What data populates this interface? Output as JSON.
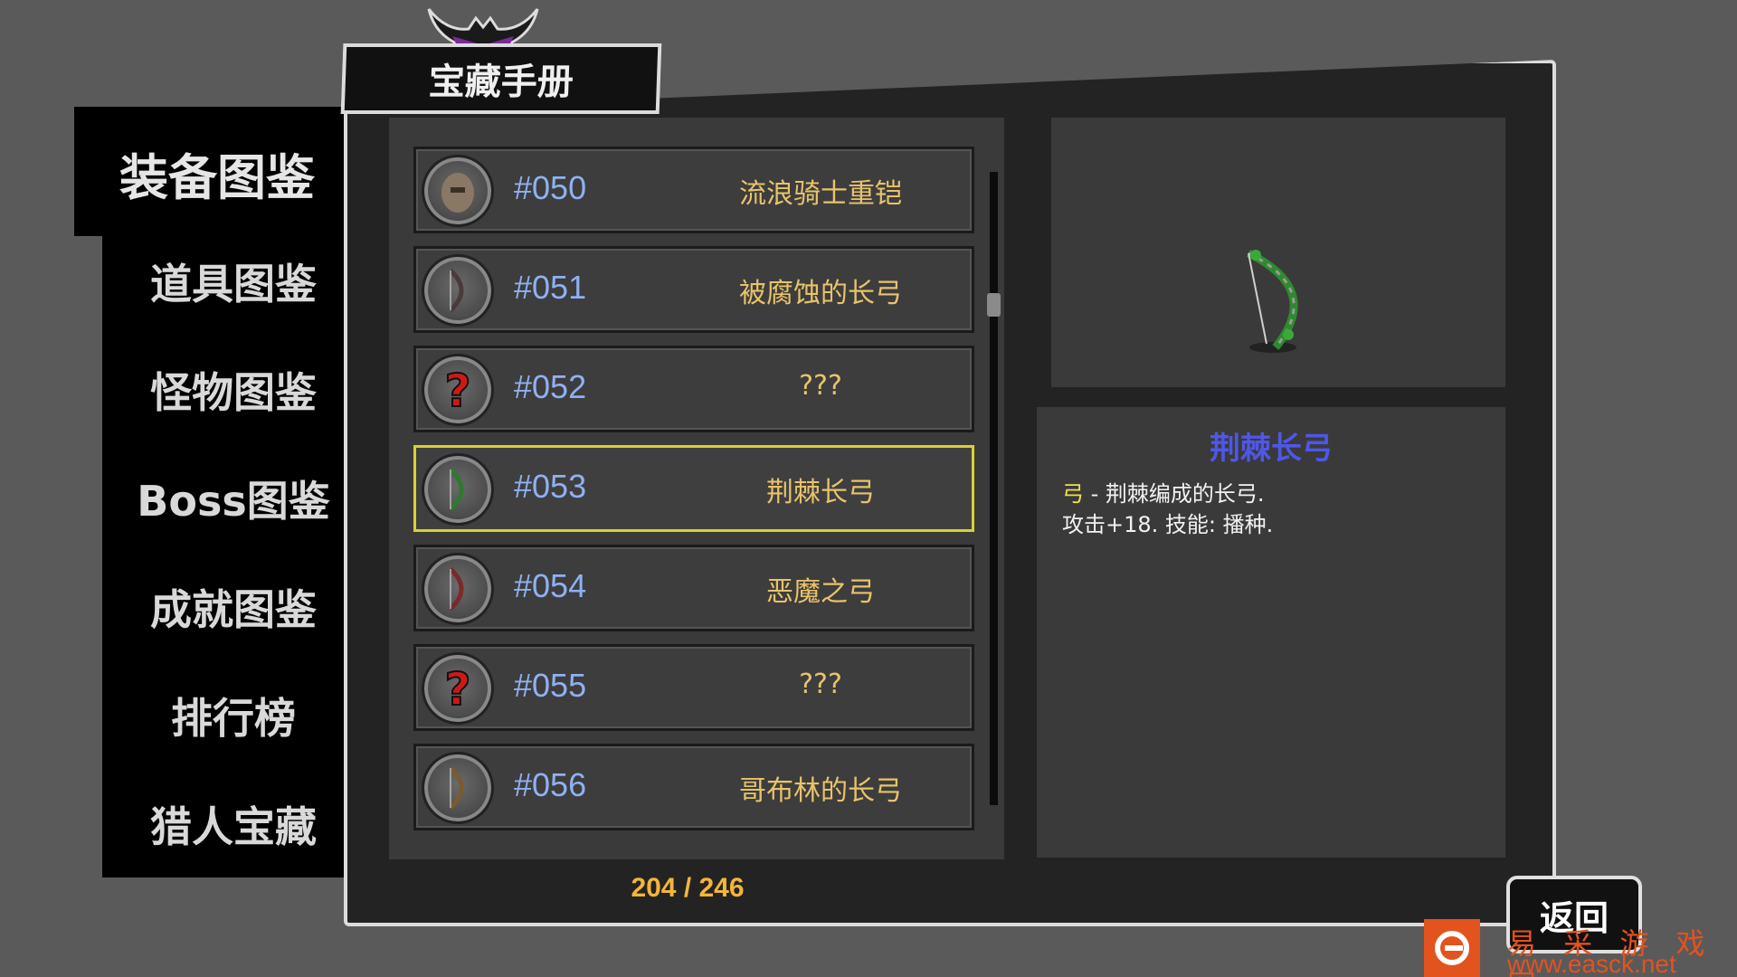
{
  "header": {
    "title": "宝藏手册"
  },
  "tabs": [
    {
      "label": "装备图鉴",
      "active": true
    },
    {
      "label": "道具图鉴",
      "active": false
    },
    {
      "label": "怪物图鉴",
      "active": false
    },
    {
      "label": "Boss图鉴",
      "active": false
    },
    {
      "label": "成就图鉴",
      "active": false
    },
    {
      "label": "排行榜",
      "active": false
    },
    {
      "label": "猎人宝藏",
      "active": false
    }
  ],
  "list": {
    "items": [
      {
        "number": "#050",
        "name": "流浪骑士重铠",
        "icon": "armor-icon"
      },
      {
        "number": "#051",
        "name": "被腐蚀的长弓",
        "icon": "bow-icon"
      },
      {
        "number": "#052",
        "name": "???",
        "icon": "unknown-icon"
      },
      {
        "number": "#053",
        "name": "荆棘长弓",
        "icon": "bow-icon",
        "selected": true
      },
      {
        "number": "#054",
        "name": "恶魔之弓",
        "icon": "bow-icon"
      },
      {
        "number": "#055",
        "name": "???",
        "icon": "unknown-icon"
      },
      {
        "number": "#056",
        "name": "哥布林的长弓",
        "icon": "bow-icon"
      }
    ],
    "counter": "204 / 246"
  },
  "detail": {
    "title": "荆棘长弓",
    "type": "弓",
    "line1_rest": " - 荆棘编成的长弓.",
    "line2": "攻击+18. 技能: 播种."
  },
  "back_button": {
    "label": "返回"
  },
  "watermark": {
    "site_name": "易 采 游 戏 网",
    "url": "www.easck.net"
  },
  "colors": {
    "number": "#8fb1f0",
    "name": "#e8c36b",
    "selected_border": "#d9d12e",
    "detail_title": "#4e57e8",
    "counter": "#f3b53b"
  }
}
